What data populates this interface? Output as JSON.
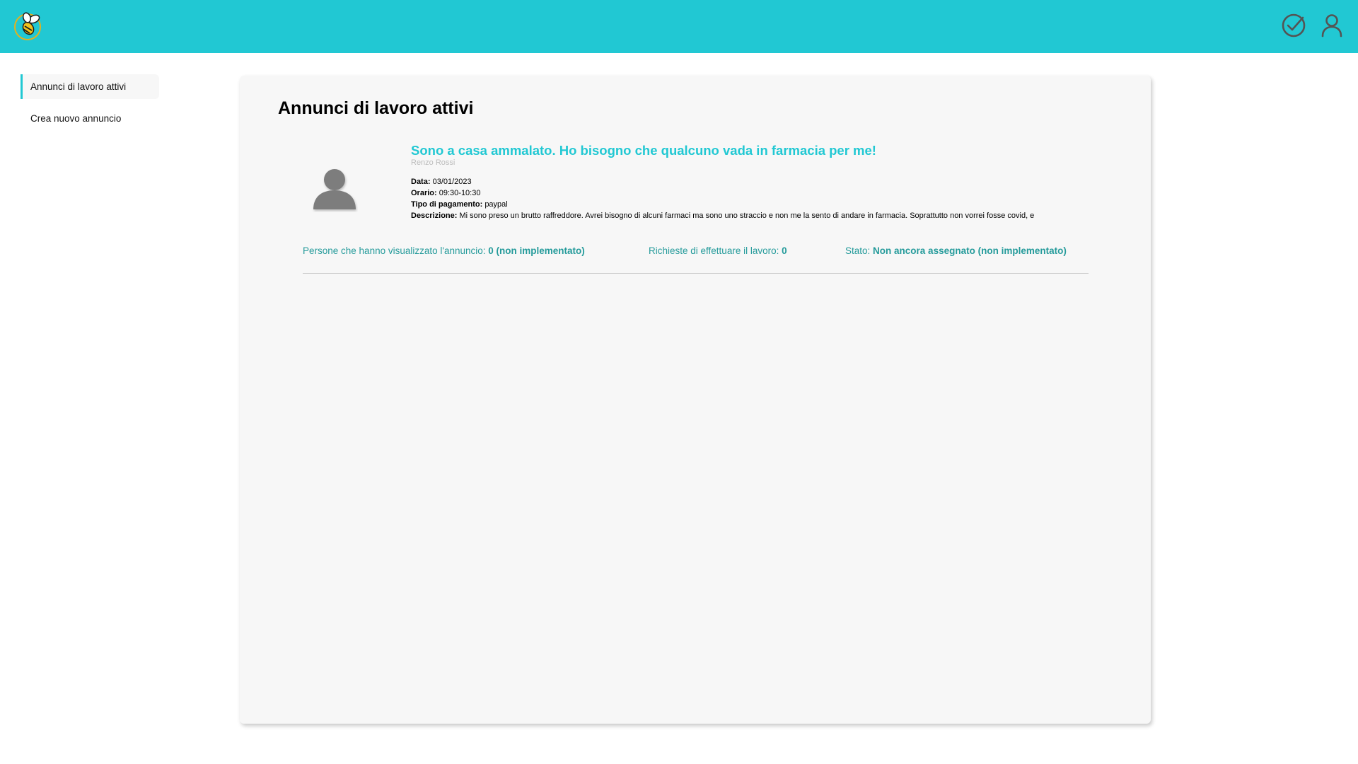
{
  "header": {
    "logo_icon": "bee-logo-icon",
    "icons": [
      "check-circle-icon",
      "user-icon"
    ],
    "accent_color": "#21c8d3"
  },
  "sidebar": {
    "items": [
      {
        "label": "Annunci di lavoro attivi",
        "active": true
      },
      {
        "label": "Crea nuovo annuncio",
        "active": false
      }
    ]
  },
  "main": {
    "title": "Annunci di lavoro attivi",
    "listing": {
      "title": "Sono a casa ammalato. Ho bisogno che qualcuno vada in farmacia per me!",
      "author": "Renzo Rossi",
      "date_label": "Data:",
      "date_value": "03/01/2023",
      "time_label": "Orario:",
      "time_value": "09:30-10:30",
      "payment_label": "Tipo di pagamento:",
      "payment_value": "paypal",
      "description_label": "Descrizione:",
      "description_value": "Mi sono preso un brutto raffreddore. Avrei bisogno di alcuni farmaci ma sono uno straccio e non me la sento di andare in farmacia. Soprattutto non vorrei fosse covid, e",
      "views_label": "Persone che hanno visualizzato l'annuncio:",
      "views_value": "0 (non implementato)",
      "requests_label": "Richieste di effettuare il lavoro:",
      "requests_value": "0",
      "status_label": "Stato:",
      "status_value": "Non ancora assegnato (non implementato)"
    }
  }
}
